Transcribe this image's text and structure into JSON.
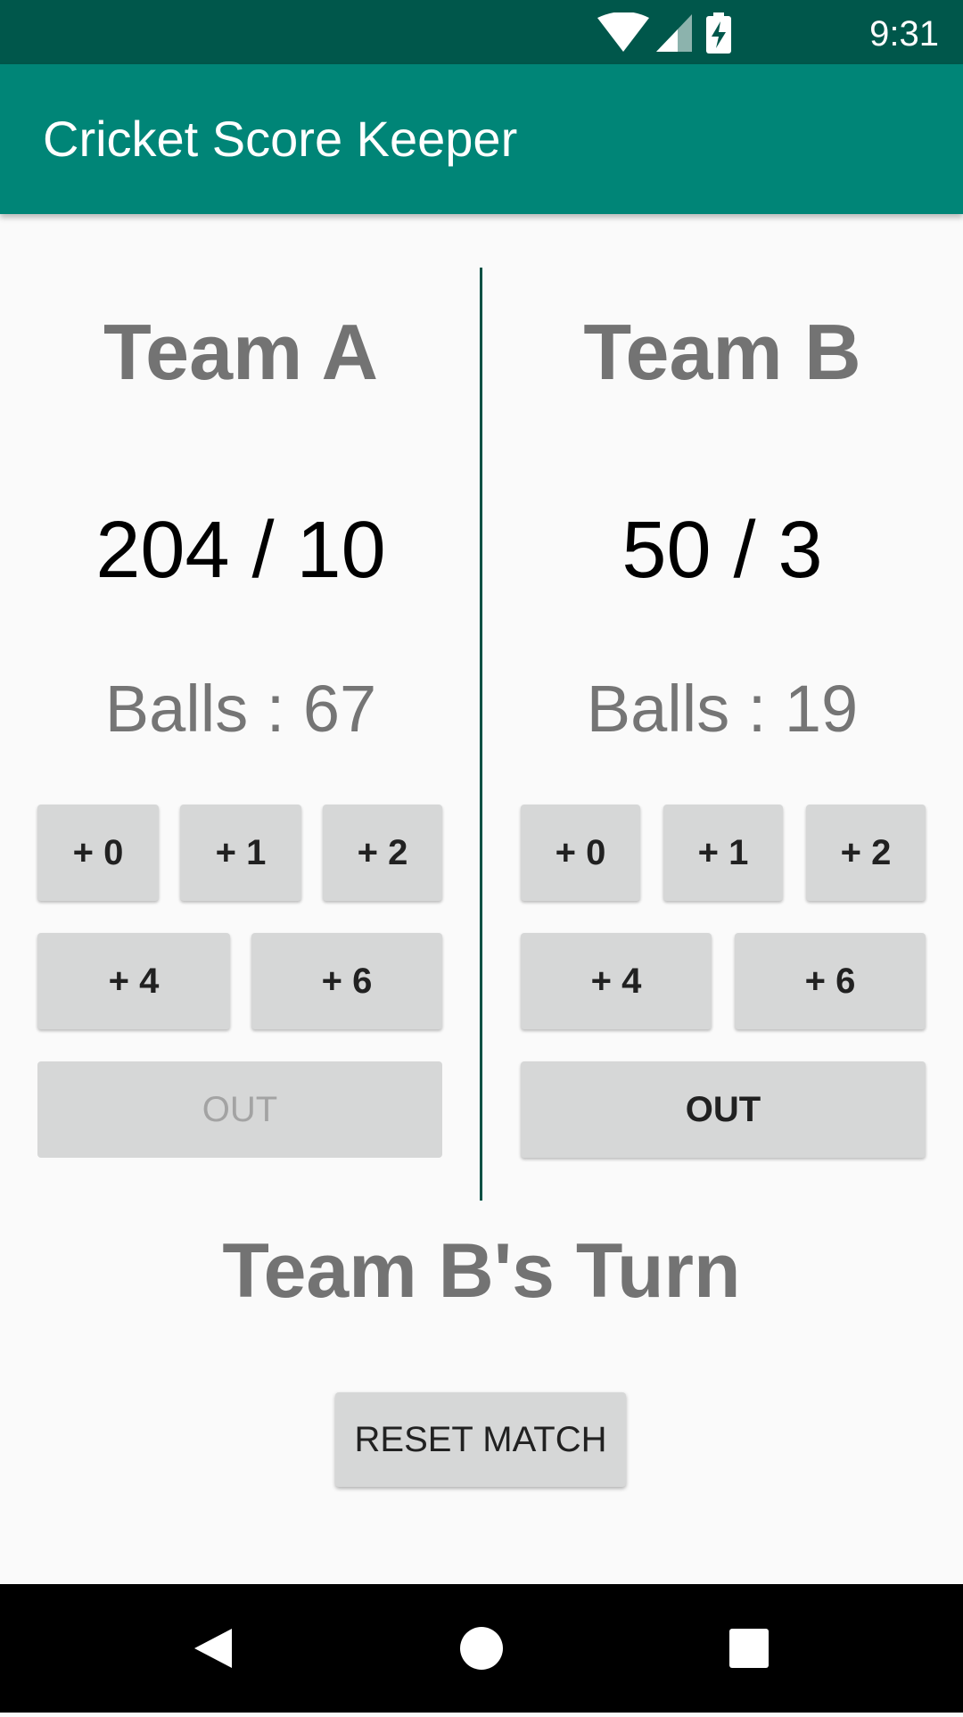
{
  "status_bar": {
    "time": "9:31",
    "icons": [
      "wifi-icon",
      "signal-icon",
      "battery-charging-icon"
    ]
  },
  "app_bar": {
    "title": "Cricket Score Keeper"
  },
  "team_a": {
    "name": "Team A",
    "score": "204 / 10",
    "balls": "Balls : 67",
    "buttons": {
      "plus0": "+ 0",
      "plus1": "+ 1",
      "plus2": "+ 2",
      "plus4": "+ 4",
      "plus6": "+ 6",
      "out": "OUT"
    }
  },
  "team_b": {
    "name": "Team B",
    "score": "50 / 3",
    "balls": "Balls : 19",
    "buttons": {
      "plus0": "+ 0",
      "plus1": "+ 1",
      "plus2": "+ 2",
      "plus4": "+ 4",
      "plus6": "+ 6",
      "out": "OUT"
    }
  },
  "turn": "Team B's Turn",
  "reset_label": "RESET MATCH",
  "colors": {
    "status_bar": "#00574b",
    "app_bar": "#008577",
    "divider": "#005044",
    "button": "#d6d7d7"
  }
}
